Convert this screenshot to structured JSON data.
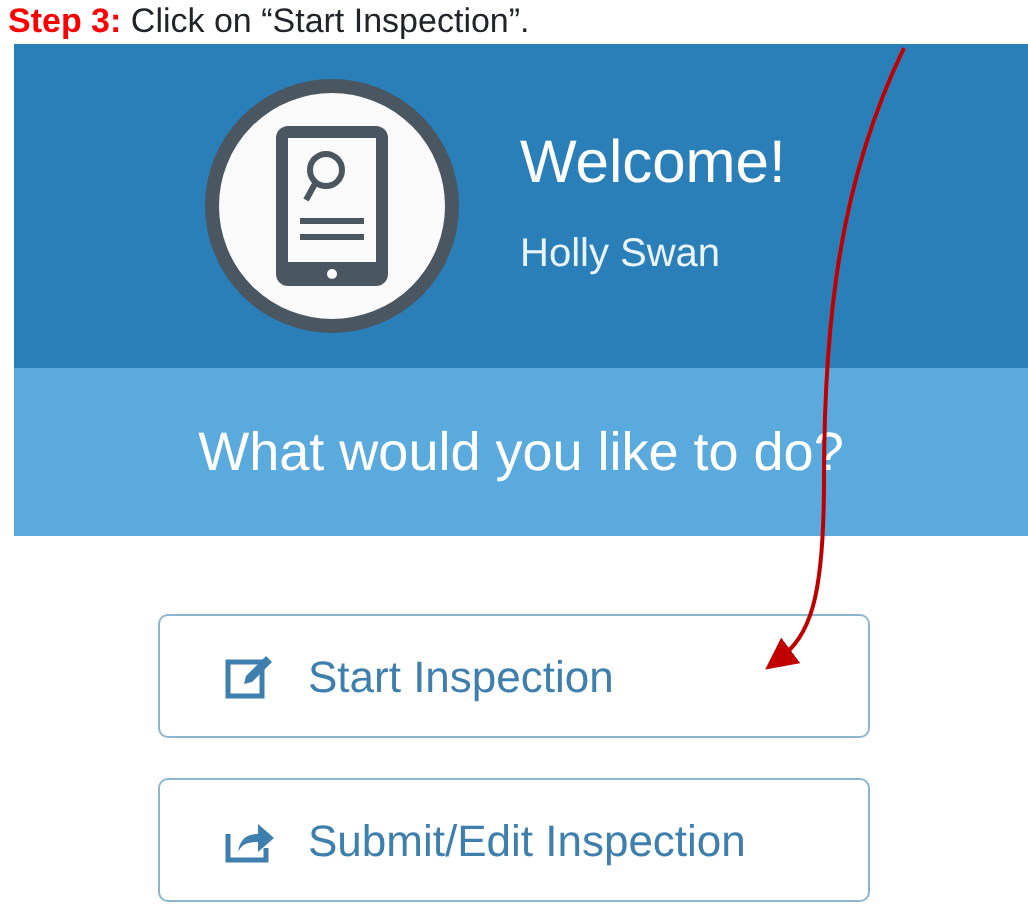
{
  "caption": {
    "step": "Step 3:",
    "text": "Click on “Start Inspection”."
  },
  "header": {
    "title": "Welcome!",
    "user_name": "Holly Swan"
  },
  "prompt": "What would you like to do?",
  "buttons": [
    {
      "label": "Start Inspection",
      "kind": "edit"
    },
    {
      "label": "Submit/Edit Inspection",
      "kind": "share"
    }
  ]
}
